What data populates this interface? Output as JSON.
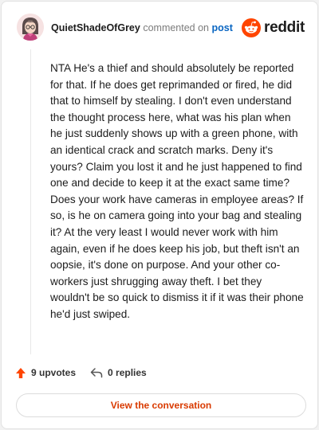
{
  "header": {
    "username": "QuietShadeOfGrey",
    "action_text": "commented on",
    "post_link": "post",
    "logo_text": "reddit",
    "brand_color": "#ff4500"
  },
  "comment": {
    "text": "NTA He's a thief and should absolutely be reported for that. If he does get reprimanded or fired, he did that to himself by stealing. I don't even understand the thought process here, what was his plan when he just suddenly shows up with a green phone, with an identical crack and scratch marks. Deny it's yours? Claim you lost it and he just happened to find one and decide to keep it at the exact same time? Does your work have cameras in employee areas? If so, is he on camera going into your bag and stealing it? At the very least I would never work with him again, even if he does keep his job, but theft isn't an oopsie, it's done on purpose. And your other co-workers just shrugging away theft. I bet they wouldn't be so quick to dismiss it if it was their phone he'd just swiped."
  },
  "actions": {
    "upvotes": "9 upvotes",
    "upvote_icon": "upvote-arrow-icon",
    "replies": "0 replies",
    "reply_icon": "reply-arrow-icon"
  },
  "button": {
    "label": "View the conversation",
    "color": "#d93a00"
  }
}
